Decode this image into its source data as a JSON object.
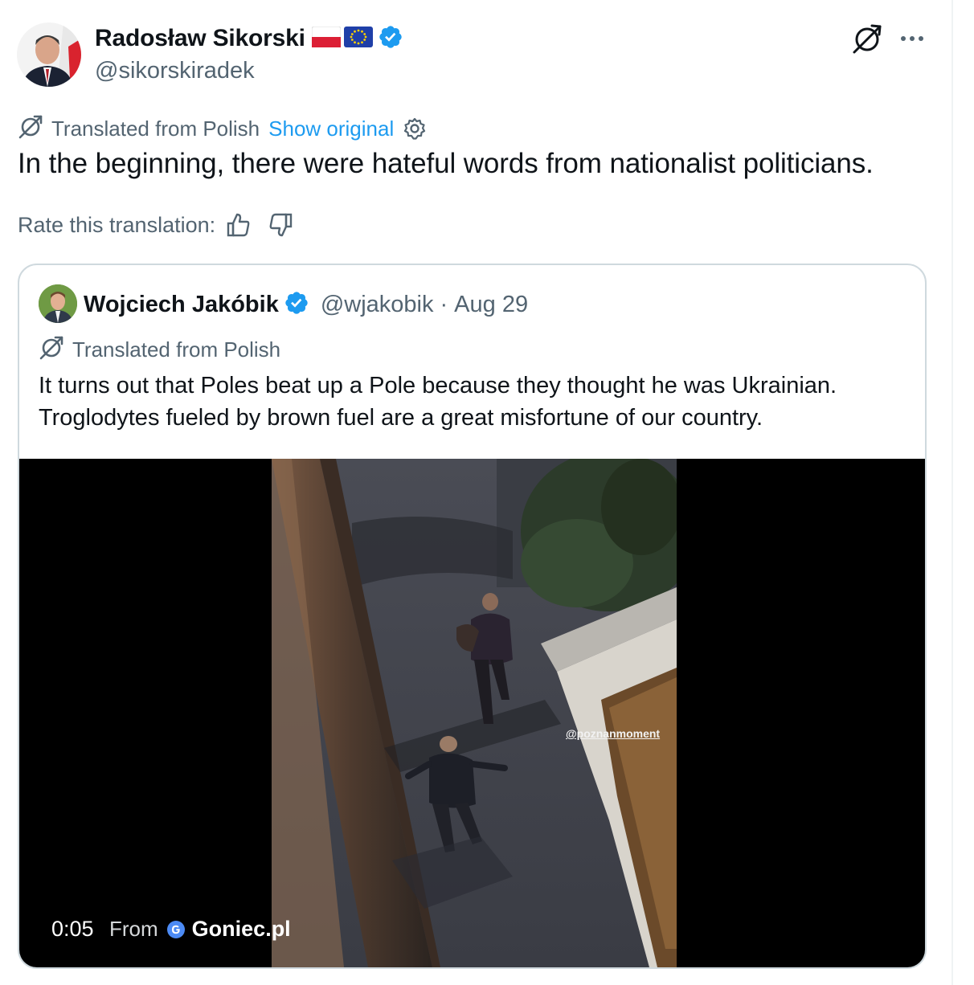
{
  "tweet": {
    "author": {
      "display_name": "Radosław Sikorski",
      "handle": "@sikorskiradek",
      "flags": [
        "poland-flag",
        "eu-flag"
      ],
      "verified": true
    },
    "translation": {
      "label": "Translated from Polish",
      "show_original": "Show original"
    },
    "text": "In the beginning, there were hateful words from nationalist politicians.",
    "rate_label": "Rate this translation:"
  },
  "quote": {
    "author": {
      "display_name": "Wojciech Jakóbik",
      "handle": "@wjakobik",
      "separator": "·",
      "date": "Aug 29",
      "verified": true
    },
    "translation_label": "Translated from Polish",
    "text_lines": [
      "It turns out that Poles beat up a Pole because they thought he was Ukrainian.",
      "Troglodytes fueled by brown fuel are a great misfortune of our country."
    ],
    "media": {
      "duration": "0:05",
      "from_label": "From",
      "source": "Goniec.pl",
      "watermark": "@poznanmoment"
    }
  },
  "colors": {
    "text_primary": "#0f1419",
    "text_secondary": "#536471",
    "link": "#1d9bf0",
    "border": "#cfd9de",
    "verified": "#1d9bf0"
  },
  "icons": [
    "translate-icon",
    "more-icon",
    "settings-icon",
    "thumbs-up-icon",
    "thumbs-down-icon",
    "verified-badge-icon",
    "google-g-icon"
  ]
}
